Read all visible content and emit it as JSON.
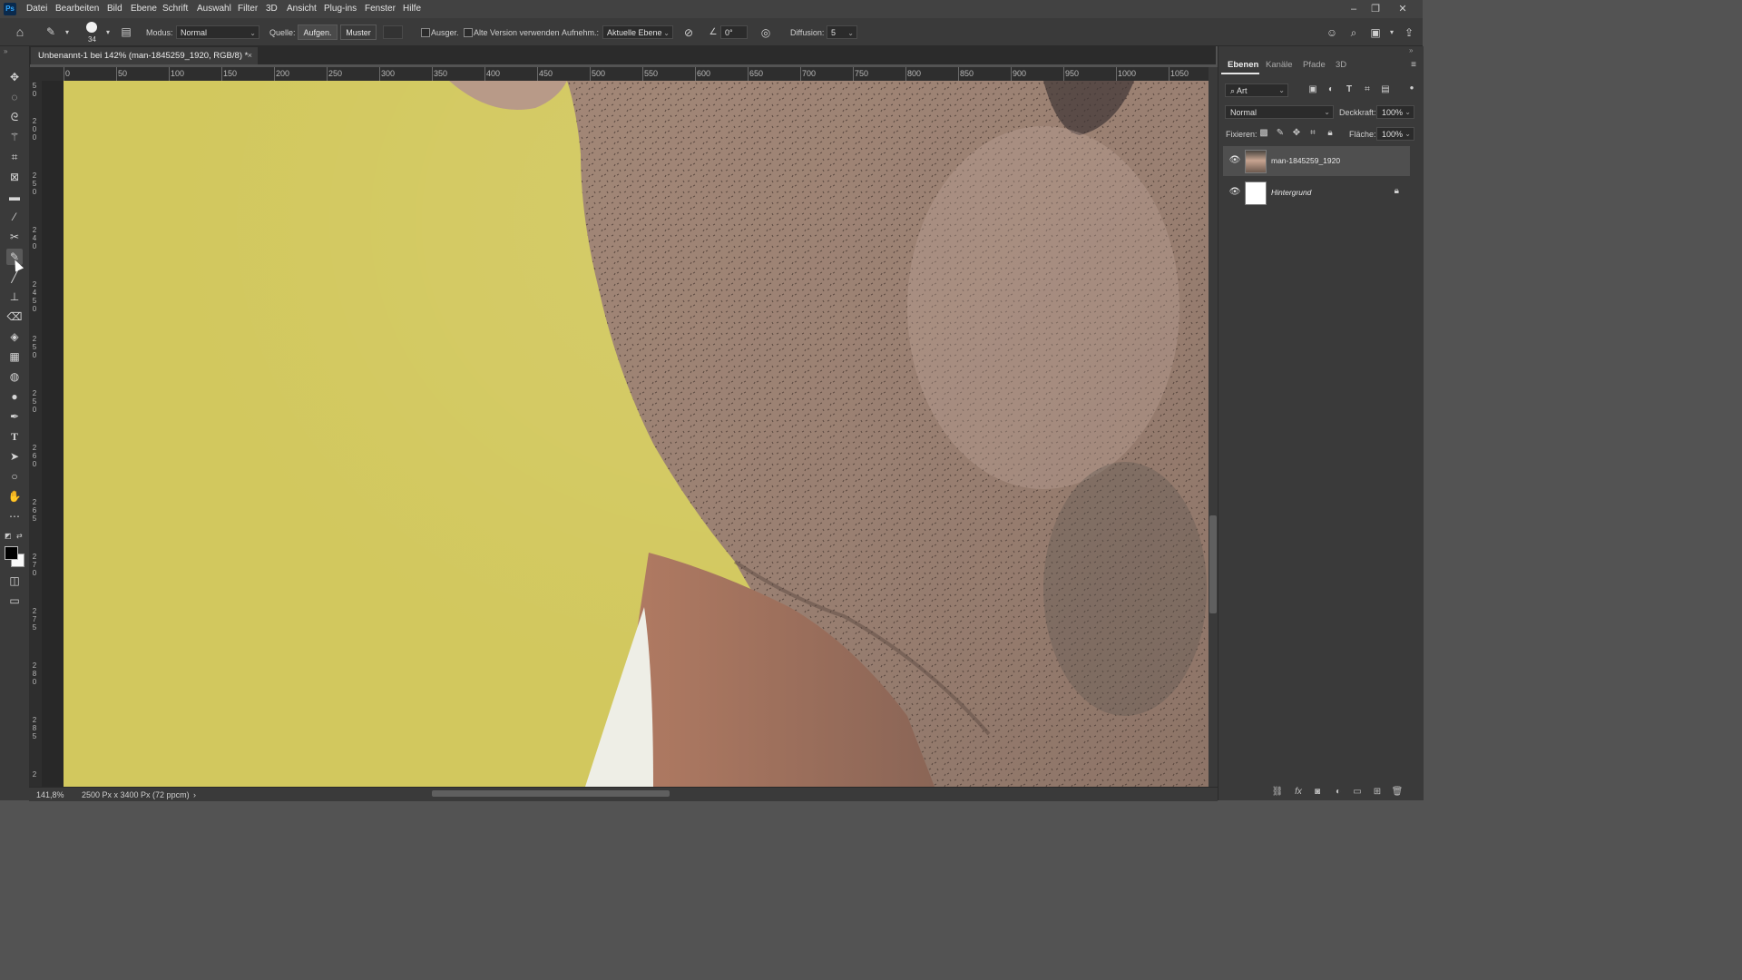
{
  "menubar": {
    "logo": "Ps",
    "items": [
      "Datei",
      "Bearbeiten",
      "Bild",
      "Ebene",
      "Schrift",
      "Auswahl",
      "Filter",
      "3D",
      "Ansicht",
      "Plug-ins",
      "Fenster",
      "Hilfe"
    ],
    "window_buttons": [
      "–",
      "❐",
      "✕"
    ]
  },
  "options": {
    "brush_size": "34",
    "mode_label": "Modus:",
    "mode_value": "Normal",
    "source_label": "Quelle:",
    "source_sampled": "Aufgen.",
    "source_pattern": "Muster",
    "aligned_label": "Ausger.",
    "legacy_label": "Alte Version verwenden",
    "sample_label": "Aufnehm.:",
    "sample_value": "Aktuelle Ebene",
    "angle_value": "0°",
    "diffusion_label": "Diffusion:",
    "diffusion_value": "5"
  },
  "document": {
    "tab_title": "Unbenannt-1 bei 142% (man-1845259_1920, RGB/8) *",
    "close": "×"
  },
  "ruler_top": {
    "labels": [
      "0",
      "50",
      "100",
      "150",
      "200",
      "250",
      "300",
      "350",
      "400",
      "450",
      "500",
      "550",
      "600",
      "650",
      "700",
      "750",
      "800",
      "850",
      "900",
      "950",
      "1000",
      "1050"
    ]
  },
  "ruler_left": {
    "labels": [
      "5",
      "0",
      "2",
      "0",
      "0",
      "2",
      "5",
      "0",
      "2",
      "4",
      "0",
      "2",
      "4",
      "5",
      "0",
      "2",
      "5",
      "0",
      "2",
      "5",
      "0",
      "2",
      "6",
      "0",
      "2",
      "6",
      "5",
      "2",
      "7",
      "0",
      "2",
      "7",
      "5",
      "2",
      "8",
      "0",
      "2",
      "8",
      "5",
      "2"
    ]
  },
  "status": {
    "zoom": "141,8%",
    "doc_size": "2500 Px x 3400 Px (72 ppcm)",
    "arrow": "›"
  },
  "panel": {
    "tabs": [
      "Ebenen",
      "Kanäle",
      "Pfade",
      "3D"
    ],
    "filter_label": "Art",
    "blend_mode": "Normal",
    "opacity_label": "Deckkraft:",
    "opacity_value": "100%",
    "lock_label": "Fixieren:",
    "fill_label": "Fläche:",
    "fill_value": "100%",
    "layers": [
      {
        "name": "man-1845259_1920",
        "selected": true
      },
      {
        "name": "Hintergrund",
        "selected": false,
        "locked": true
      }
    ]
  },
  "colors": {
    "accent": "#31a8ff",
    "canvas_yellow": "#d2c85e",
    "skin": "#9a7a68"
  }
}
